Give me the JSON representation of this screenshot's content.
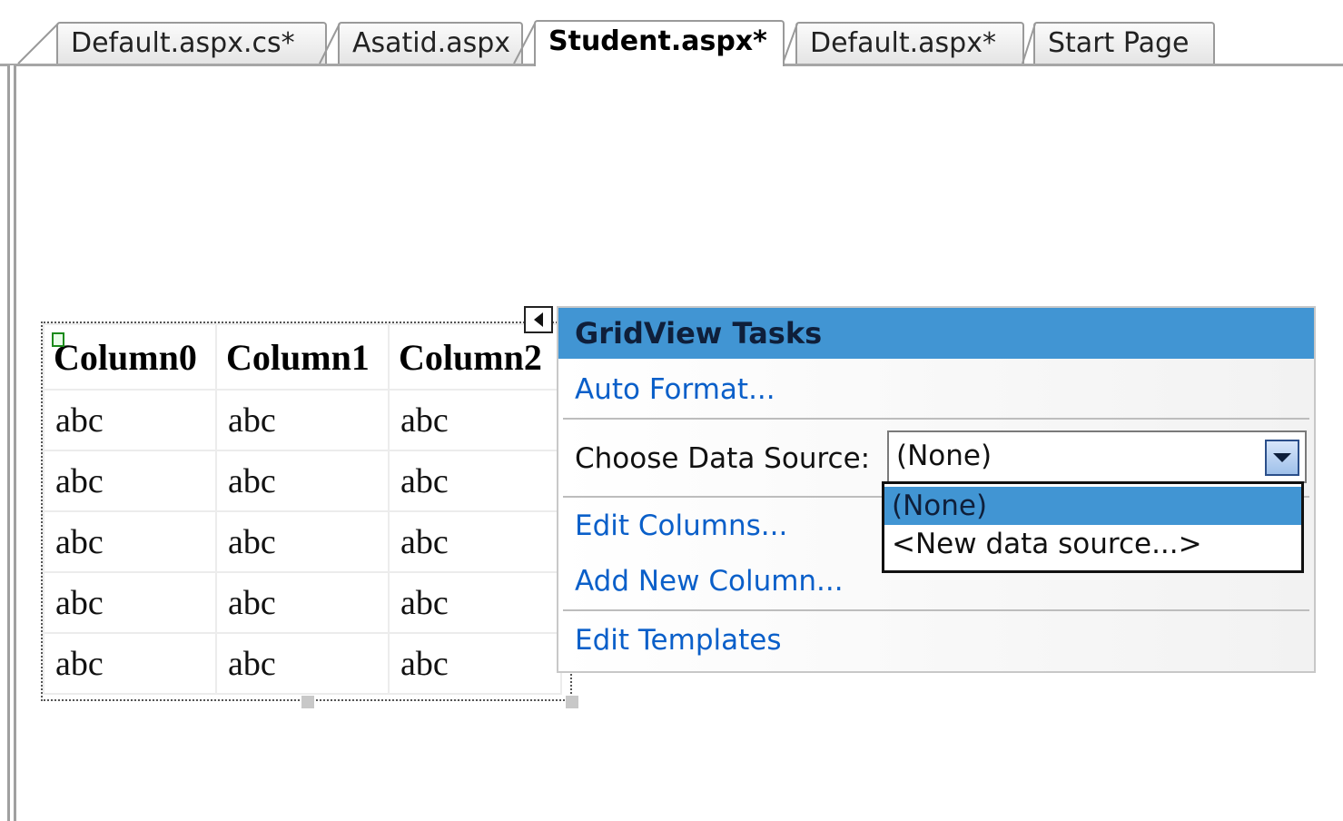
{
  "tabs": [
    {
      "label": "Default.aspx.cs*",
      "active": false
    },
    {
      "label": "Asatid.aspx",
      "active": false
    },
    {
      "label": "Student.aspx*",
      "active": true
    },
    {
      "label": "Default.aspx*",
      "active": false
    },
    {
      "label": "Start Page",
      "active": false
    }
  ],
  "gridview": {
    "columns": [
      "Column0",
      "Column1",
      "Column2"
    ],
    "rows": [
      [
        "abc",
        "abc",
        "abc"
      ],
      [
        "abc",
        "abc",
        "abc"
      ],
      [
        "abc",
        "abc",
        "abc"
      ],
      [
        "abc",
        "abc",
        "abc"
      ],
      [
        "abc",
        "abc",
        "abc"
      ]
    ]
  },
  "tasks_panel": {
    "title": "GridView Tasks",
    "auto_format": "Auto Format...",
    "choose_data_source_label": "Choose Data Source:",
    "data_source_value": "(None)",
    "edit_columns": "Edit Columns...",
    "add_new_column": "Add New Column...",
    "edit_templates": "Edit Templates"
  },
  "data_source_options": [
    {
      "label": "(None)",
      "selected": true
    },
    {
      "label": "<New data source...>",
      "selected": false
    }
  ],
  "colors": {
    "header_blue": "#4195d3",
    "link_blue": "#0a5fc9"
  },
  "icons": {
    "smart_tag": "smart-tag-collapse-icon",
    "dropdown": "dropdown-arrow-icon",
    "grid_glyph": "gridview-glyph-icon"
  }
}
